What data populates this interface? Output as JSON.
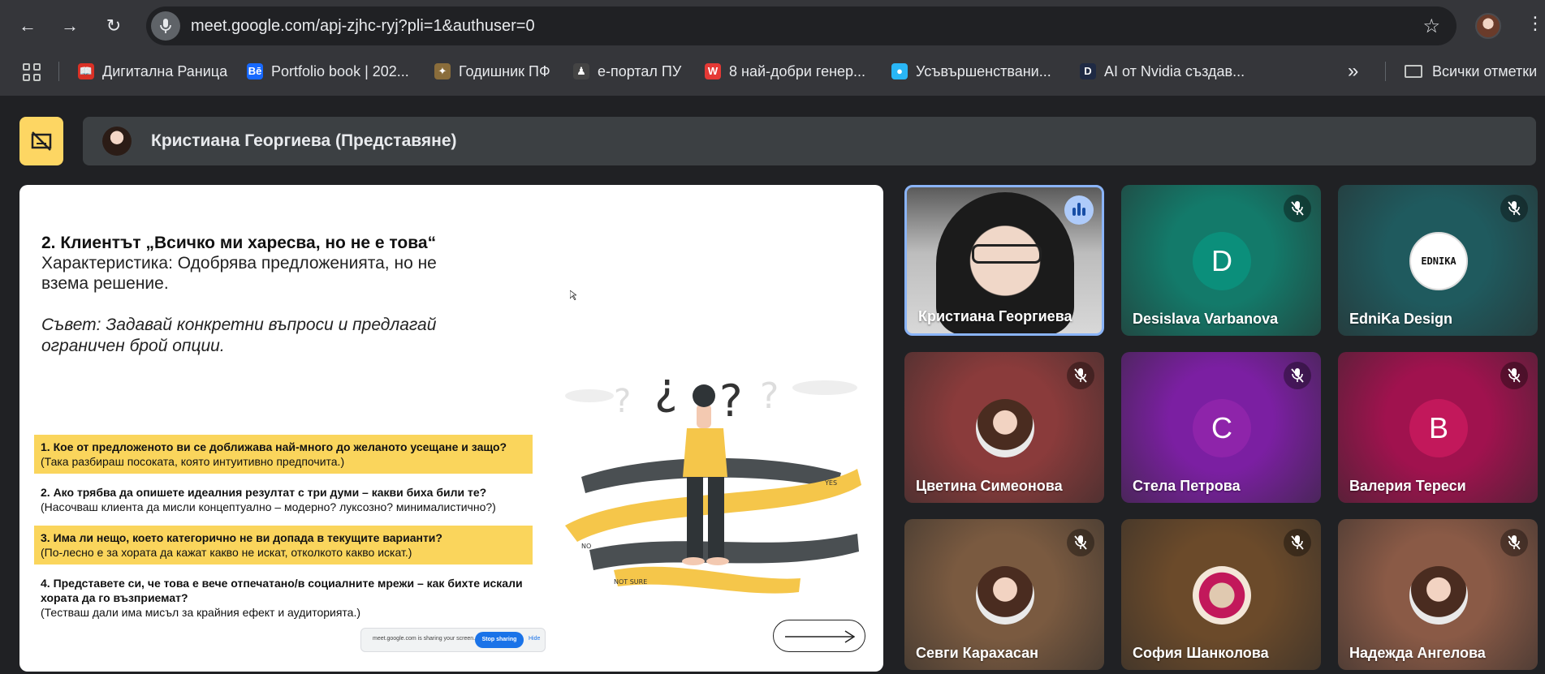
{
  "browser": {
    "url": "meet.google.com/apj-zjhc-ryj?pli=1&authuser=0",
    "bookmarks": [
      {
        "label": "Дигитална Раница",
        "color": "#d93025",
        "glyph": "📖"
      },
      {
        "label": "Portfolio book | 202...",
        "color": "#1769ff",
        "glyph": "Bē"
      },
      {
        "label": "Годишник ПФ",
        "color": "#8a6d3b",
        "glyph": "✦"
      },
      {
        "label": "е-портал ПУ",
        "color": "#444444",
        "glyph": "♟"
      },
      {
        "label": "8 най-добри генер...",
        "color": "#e53935",
        "glyph": "W"
      },
      {
        "label": "Усъвършенствани...",
        "color": "#29b6f6",
        "glyph": "●"
      },
      {
        "label": "AI от Nvidia създав...",
        "color": "#1f2a44",
        "glyph": "D"
      }
    ],
    "bookmarks_folder": "Всички отметки"
  },
  "meet": {
    "presenter_label": "Кристиана Георгиева (Представяне)",
    "slide": {
      "title": "2. Клиентът „Всичко ми харесва, но не е това“",
      "subtitle": "Характеристика: Одобрява предложенията, но не взема решение.",
      "advice": "Съвет: Задавай конкретни въпроси и предлагай ограничен брой опции.",
      "questions": [
        {
          "q": "1. Кое от предложеното ви се доближава най-много до желаното усещане и защо?",
          "note": "(Така разбираш посоката, която интуитивно предпочита.)",
          "highlight": true
        },
        {
          "q": "2. Ако трябва да опишете идеалния резултат с три думи – какви биха били те?",
          "note": "(Насочваш клиента да мисли концептуално – модерно? луксозно? минималистично?)",
          "highlight": false
        },
        {
          "q": "3. Има ли нещо, което категорично не ви допада в текущите варианти?",
          "note": "(По-лесно е за хората да кажат какво не искат, отколкото какво искат.)",
          "highlight": true
        },
        {
          "q": "4. Представете си, че това е вече отпечатано/в социалните мрежи – как бихте искали хората да го възприемат?",
          "note": "(Тестваш дали има мисъл за крайния ефект и аудиторията.)",
          "highlight": false
        }
      ],
      "share_text": "meet.google.com is sharing your screen.",
      "stop_label": "Stop sharing",
      "hide_label": "Hide",
      "illus_labels": {
        "yes": "YES",
        "no": "NO",
        "not_sure": "NOT SURE"
      }
    },
    "participants": [
      {
        "name": "Кристиана Георгиева",
        "type": "video",
        "speaking": true
      },
      {
        "name": "Desislava Varbanova",
        "type": "letter",
        "letter": "D",
        "bg": "#137a6a",
        "avatar": "#0b8f7b",
        "muted": true
      },
      {
        "name": "EdniKa Design",
        "type": "logo",
        "logo_text": "EDNIKA",
        "bg": "#1f5a5e",
        "muted": true
      },
      {
        "name": "Цветина Симеонова",
        "type": "photo",
        "bg": "#8a3b3b",
        "muted": true
      },
      {
        "name": "Стела Петрова",
        "type": "letter",
        "letter": "C",
        "bg": "#7b1fa2",
        "avatar": "#8e24aa",
        "muted": true
      },
      {
        "name": "Валерия Тереси",
        "type": "letter",
        "letter": "B",
        "bg": "#a0124e",
        "avatar": "#c2185b",
        "muted": true
      },
      {
        "name": "Севги Карахасан",
        "type": "photo",
        "bg": "#7a5a40",
        "muted": true
      },
      {
        "name": "София Шанколова",
        "type": "cards",
        "bg": "#6b4a2a",
        "muted": true
      },
      {
        "name": "Надежда Ангелова",
        "type": "photo",
        "bg": "#8a5a46",
        "muted": true
      }
    ]
  }
}
